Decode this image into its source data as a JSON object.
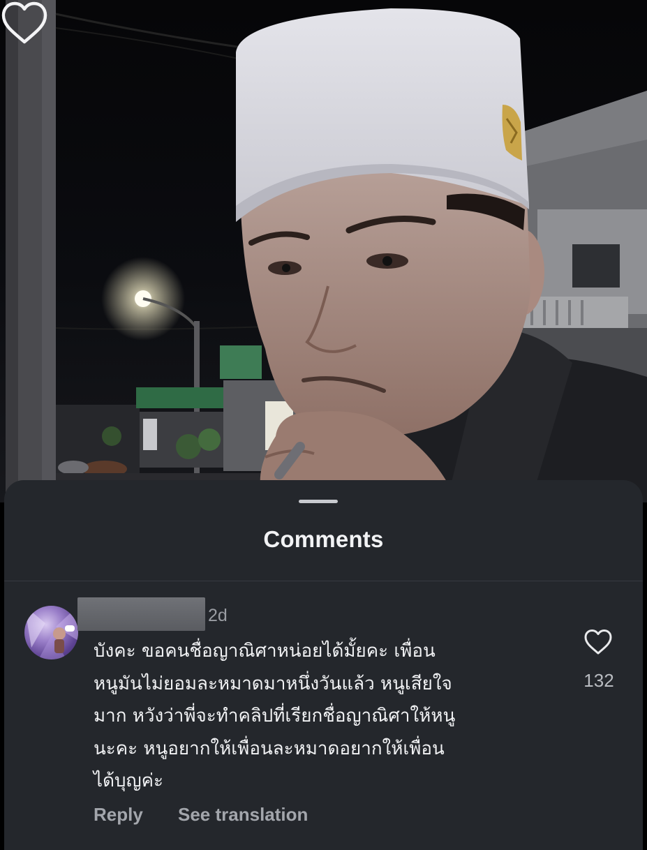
{
  "sheet": {
    "title": "Comments"
  },
  "comment": {
    "timestamp": "2d",
    "text": "บังคะ ขอคนชื่อญาณิศาหน่อยได้มั้ยคะ เพื่อน\nหนูมันไม่ยอมละหมาดมาหนึ่งวันแล้ว หนูเสียใจ\nมาก หวังว่าพี่จะทำคลิปที่เรียกชื่อญาณิศาให้หนู\nนะคะ หนูอยากให้เพื่อนละหมาดอยากให้เพื่อน\nได้บุญค่ะ",
    "like_count": "132",
    "reply_label": "Reply",
    "translate_label": "See translation",
    "like_icon": "heart-outline-icon"
  },
  "video": {
    "like_icon": "heart-outline-icon"
  },
  "colors": {
    "sheet_background": "#24272c",
    "text_primary": "#f1f2f4",
    "text_secondary": "#a3a6ac"
  }
}
